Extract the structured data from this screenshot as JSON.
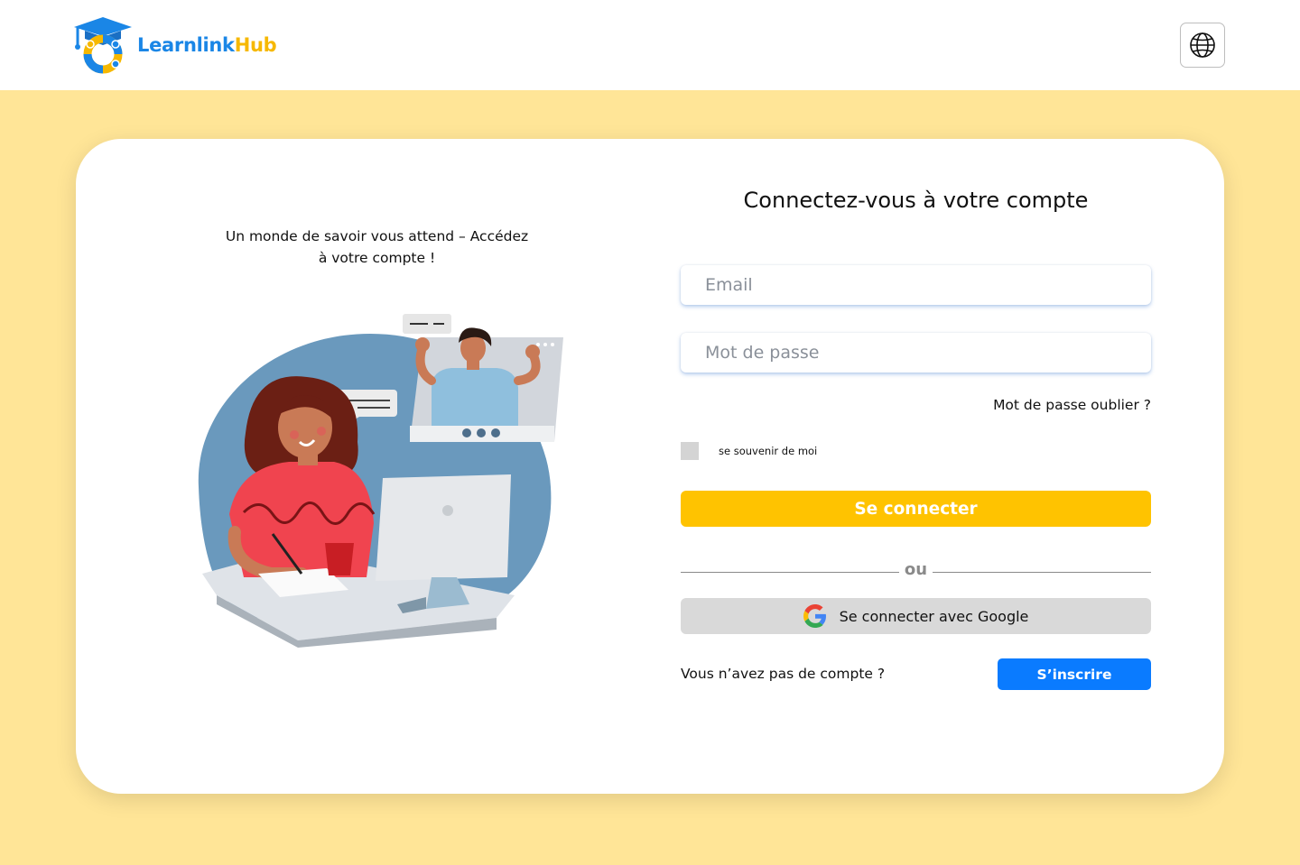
{
  "brand": {
    "name_part1": "Learnlink",
    "name_part2": "Hub",
    "logo_icon": "graduation-cap-logo",
    "primary_color": "#1a86e6",
    "accent_color": "#f6b800"
  },
  "header": {
    "language_icon": "globe-icon"
  },
  "left_panel": {
    "tagline": "Un monde de savoir vous attend – Accédez à votre compte !",
    "illustration": "woman-studying-video-call-illustration"
  },
  "login_form": {
    "title": "Connectez-vous à votre compte",
    "email_placeholder": "Email",
    "email_value": "",
    "password_placeholder": "Mot de passe",
    "password_value": "",
    "forgot_password": "Mot de passe oublier ?",
    "remember_me": "se souvenir de moi",
    "remember_checked": false,
    "submit_label": "Se connecter",
    "submit_color": "#FFC300",
    "divider_text": "ou",
    "google_label": "Se connecter avec Google",
    "google_icon": "google-icon",
    "no_account_text": "Vous n’avez pas de compte ?",
    "signup_label": "S’inscrire",
    "signup_color": "#0A7BFF"
  },
  "background_color": "#FFE597"
}
